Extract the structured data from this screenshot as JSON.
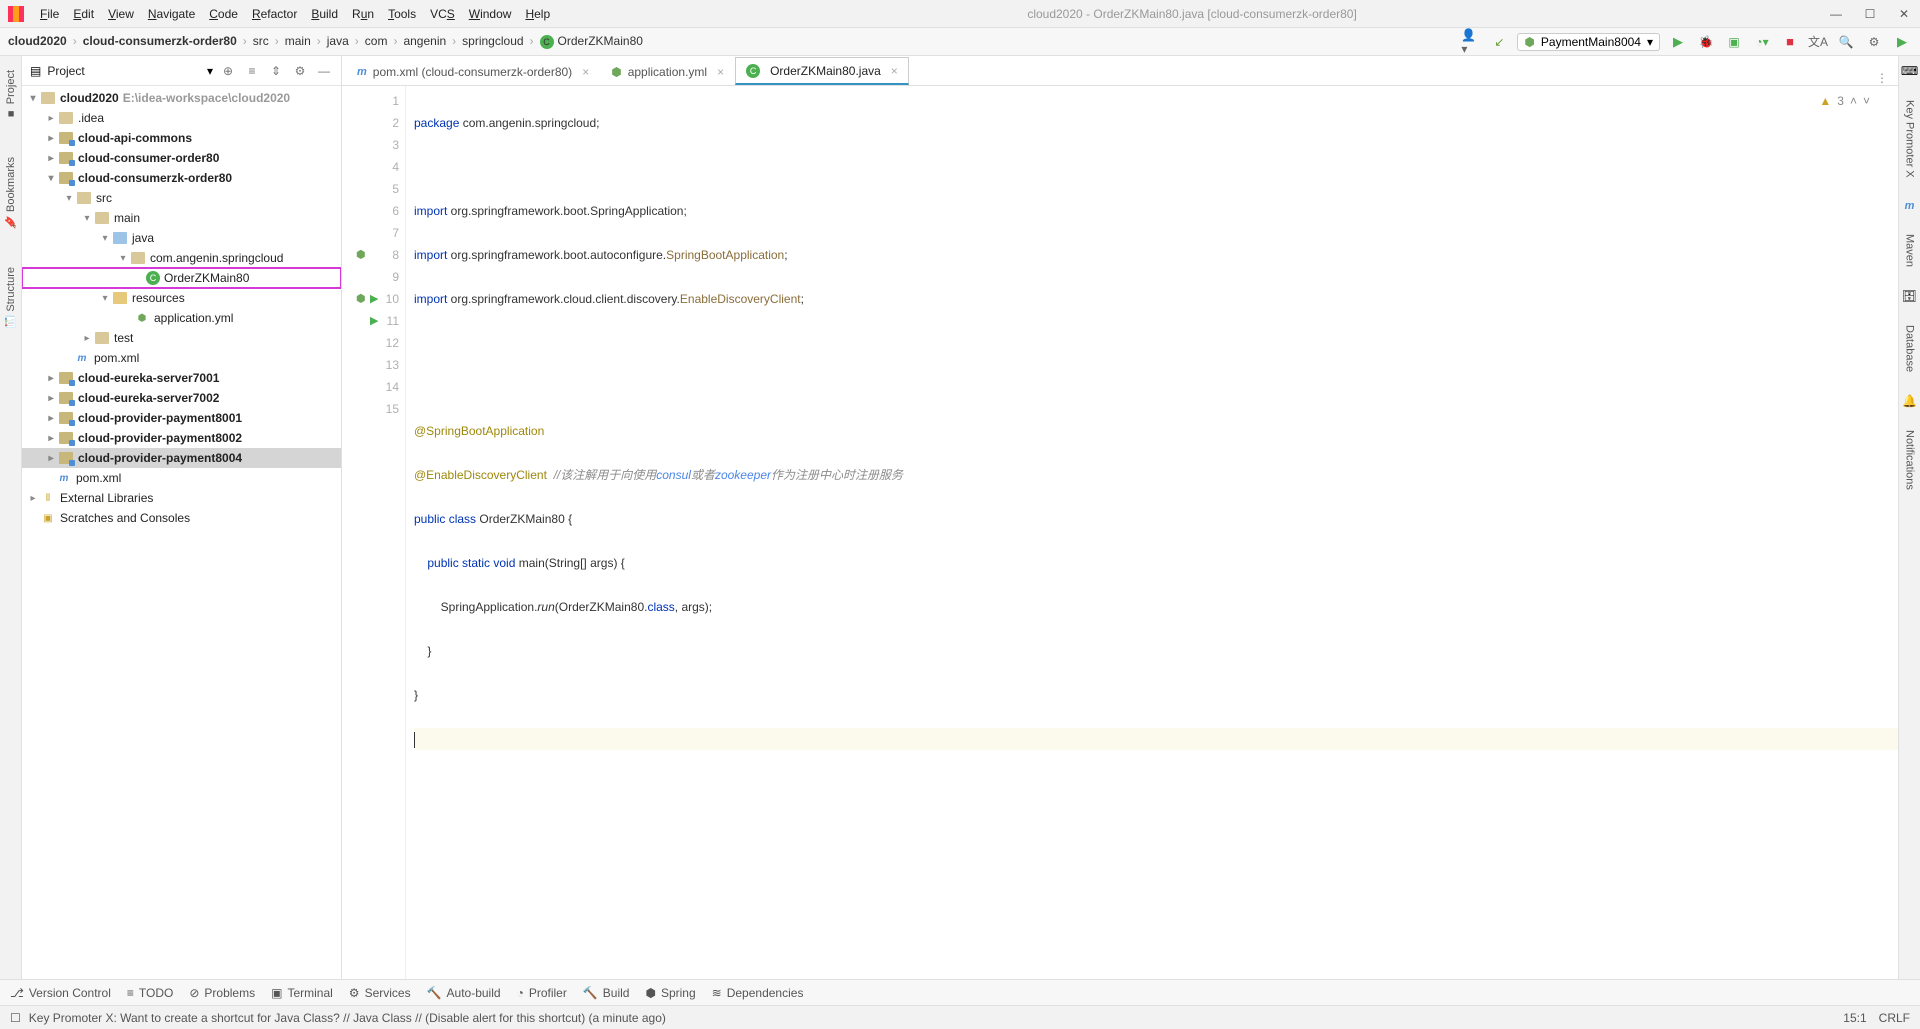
{
  "window": {
    "title": "cloud2020 - OrderZKMain80.java [cloud-consumerzk-order80]"
  },
  "menu": [
    "File",
    "Edit",
    "View",
    "Navigate",
    "Code",
    "Refactor",
    "Build",
    "Run",
    "Tools",
    "VCS",
    "Window",
    "Help"
  ],
  "breadcrumb": [
    "cloud2020",
    "cloud-consumerzk-order80",
    "src",
    "main",
    "java",
    "com",
    "angenin",
    "springcloud",
    "OrderZKMain80"
  ],
  "run_config": "PaymentMain8004",
  "project": {
    "title": "Project",
    "root": "cloud2020",
    "root_hint": "E:\\idea-workspace\\cloud2020",
    "idea": ".idea",
    "mods": {
      "api": "cloud-api-commons",
      "order80": "cloud-consumer-order80",
      "zk80": "cloud-consumerzk-order80",
      "eureka1": "cloud-eureka-server7001",
      "eureka2": "cloud-eureka-server7002",
      "pay1": "cloud-provider-payment8001",
      "pay2": "cloud-provider-payment8002",
      "pay4": "cloud-provider-payment8004"
    },
    "zk": {
      "src": "src",
      "main": "main",
      "java": "java",
      "pkg": "com.angenin.springcloud",
      "cls": "OrderZKMain80",
      "resources": "resources",
      "yml": "application.yml",
      "test": "test",
      "pom": "pom.xml"
    },
    "root_pom": "pom.xml",
    "ext_lib": "External Libraries",
    "scratches": "Scratches and Consoles"
  },
  "tabs": [
    {
      "label": "pom.xml (cloud-consumerzk-order80)",
      "icon": "pom"
    },
    {
      "label": "application.yml",
      "icon": "yml"
    },
    {
      "label": "OrderZKMain80.java",
      "icon": "class",
      "active": true
    }
  ],
  "inspection": {
    "warn_count": "3"
  },
  "code": {
    "l1_pkg": "package",
    "l1_rest": " com.angenin.springcloud;",
    "l3_imp": "import",
    "l3_rest": " org.springframework.boot.SpringApplication;",
    "l4_imp": "import",
    "l4_rest": " org.springframework.boot.autoconfigure.",
    "l4_cls": "SpringBootApplication",
    "l4_semi": ";",
    "l5_imp": "import",
    "l5_rest": " org.springframework.cloud.client.discovery.",
    "l5_cls": "EnableDiscoveryClient",
    "l5_semi": ";",
    "l8_ann": "@SpringBootApplication",
    "l9_ann": "@EnableDiscoveryClient",
    "l9_com": "  //该注解用于向使用",
    "l9_hi1": "consul",
    "l9_mid": "或者",
    "l9_hi2": "zookeeper",
    "l9_end": "作为注册中心时注册服务",
    "l10_pub": "public ",
    "l10_cls": "class ",
    "l10_name": "OrderZKMain80",
    "l10_brace": " {",
    "l11_sp": "    ",
    "l11_pub": "public ",
    "l11_stat": "static ",
    "l11_void": "void ",
    "l11_main": "main",
    "l11_args": "(String[] args) {",
    "l12_sp": "        ",
    "l12_run": "SpringApplication.",
    "l12_runfn": "run",
    "l12_open": "(OrderZKMain80.",
    "l12_class": "class",
    "l12_close": ", args);",
    "l13": "    }",
    "l14": "}"
  },
  "bottom": [
    "Version Control",
    "TODO",
    "Problems",
    "Terminal",
    "Services",
    "Auto-build",
    "Profiler",
    "Build",
    "Spring",
    "Dependencies"
  ],
  "status": {
    "msg": "Key Promoter X: Want to create a shortcut for Java Class? // Java Class // (Disable alert for this shortcut) (a minute ago)",
    "pos": "15:1",
    "enc": "CRLF"
  },
  "right_tools": [
    "Key Promoter X",
    "Maven",
    "Database",
    "Notifications"
  ]
}
